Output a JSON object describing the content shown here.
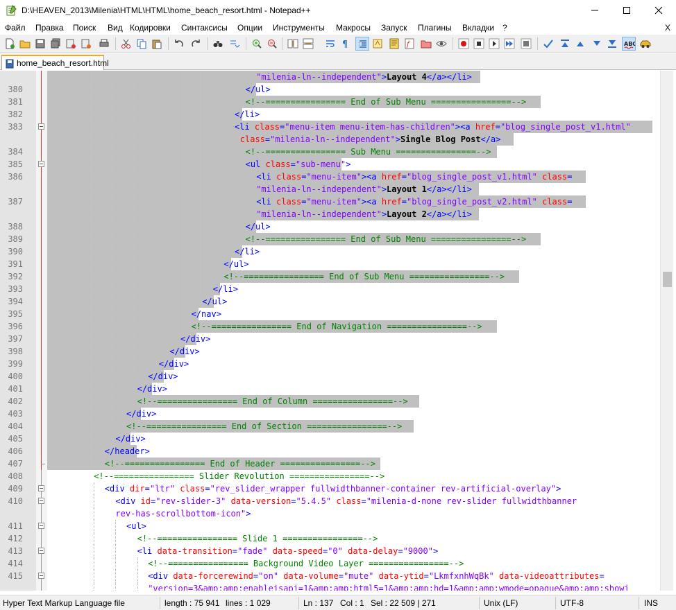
{
  "window": {
    "title": "D:\\HEAVEN_2013\\Milenia\\HTML\\HTML\\home_beach_resort.html - Notepad++"
  },
  "menu": {
    "items": [
      "Файл",
      "Правка",
      "Поиск",
      "Вид",
      "Кодировки",
      "Синтаксисы",
      "Опции",
      "Инструменты",
      "Макросы",
      "Запуск",
      "Плагины",
      "Вкладки",
      "?"
    ],
    "close_label": "X"
  },
  "tab": {
    "label": "home_beach_resort.html"
  },
  "editor": {
    "lines": [
      {
        "n": "",
        "code": [
          [
            "val",
            "\"milenia-ln--independent\""
          ],
          [
            "tag",
            ">"
          ],
          [
            "txt",
            "Layout 4"
          ],
          [
            "tag",
            "</a></li>"
          ]
        ]
      },
      {
        "n": "380",
        "code": [
          [
            "tag",
            "</ul>"
          ]
        ]
      },
      {
        "n": "381",
        "code": [
          [
            "com",
            "<!--================ End of Sub Menu ================-->"
          ]
        ]
      },
      {
        "n": "382",
        "code": [
          [
            "tag",
            "</li>"
          ]
        ]
      },
      {
        "n": "383",
        "code": [
          [
            "tag",
            "<li "
          ],
          [
            "attr",
            "class"
          ],
          [
            "tag",
            "="
          ],
          [
            "val",
            "\"menu-item menu-item-has-children\""
          ],
          [
            "tag",
            "><a "
          ],
          [
            "attr",
            "href"
          ],
          [
            "tag",
            "="
          ],
          [
            "val",
            "\"blog_single_post_v1.html\""
          ]
        ]
      },
      {
        "n": "",
        "code": [
          [
            "attr",
            "class"
          ],
          [
            "tag",
            "="
          ],
          [
            "val",
            "\"milenia-ln--independent\""
          ],
          [
            "tag",
            ">"
          ],
          [
            "txt",
            "Single Blog Post"
          ],
          [
            "tag",
            "</a>"
          ]
        ]
      },
      {
        "n": "384",
        "code": [
          [
            "com",
            "<!--================ Sub Menu ================-->"
          ]
        ]
      },
      {
        "n": "385",
        "code": [
          [
            "tag",
            "<ul "
          ],
          [
            "attr",
            "class"
          ],
          [
            "tag",
            "="
          ],
          [
            "val",
            "\"sub-menu\""
          ],
          [
            "tag",
            ">"
          ]
        ]
      },
      {
        "n": "386",
        "code": [
          [
            "tag",
            "<li "
          ],
          [
            "attr",
            "class"
          ],
          [
            "tag",
            "="
          ],
          [
            "val",
            "\"menu-item\""
          ],
          [
            "tag",
            "><a "
          ],
          [
            "attr",
            "href"
          ],
          [
            "tag",
            "="
          ],
          [
            "val",
            "\"blog_single_post_v1.html\""
          ],
          [
            "tag",
            " "
          ],
          [
            "attr",
            "class"
          ],
          [
            "tag",
            "="
          ]
        ]
      },
      {
        "n": "",
        "code": [
          [
            "val",
            "\"milenia-ln--independent\""
          ],
          [
            "tag",
            ">"
          ],
          [
            "txt",
            "Layout 1"
          ],
          [
            "tag",
            "</a></li>"
          ]
        ]
      },
      {
        "n": "387",
        "code": [
          [
            "tag",
            "<li "
          ],
          [
            "attr",
            "class"
          ],
          [
            "tag",
            "="
          ],
          [
            "val",
            "\"menu-item\""
          ],
          [
            "tag",
            "><a "
          ],
          [
            "attr",
            "href"
          ],
          [
            "tag",
            "="
          ],
          [
            "val",
            "\"blog_single_post_v2.html\""
          ],
          [
            "tag",
            " "
          ],
          [
            "attr",
            "class"
          ],
          [
            "tag",
            "="
          ]
        ]
      },
      {
        "n": "",
        "code": [
          [
            "val",
            "\"milenia-ln--independent\""
          ],
          [
            "tag",
            ">"
          ],
          [
            "txt",
            "Layout 2"
          ],
          [
            "tag",
            "</a></li>"
          ]
        ]
      },
      {
        "n": "388",
        "code": [
          [
            "tag",
            "</ul>"
          ]
        ]
      },
      {
        "n": "389",
        "code": [
          [
            "com",
            "<!--================ End of Sub Menu ================-->"
          ]
        ]
      },
      {
        "n": "390",
        "code": [
          [
            "tag",
            "</li>"
          ]
        ]
      },
      {
        "n": "391",
        "code": [
          [
            "tag",
            "</ul>"
          ]
        ]
      },
      {
        "n": "392",
        "code": [
          [
            "com",
            "<!--================ End of Sub Menu ================-->"
          ]
        ]
      },
      {
        "n": "393",
        "code": [
          [
            "tag",
            "</li>"
          ]
        ]
      },
      {
        "n": "394",
        "code": [
          [
            "tag",
            "</ul>"
          ]
        ]
      },
      {
        "n": "395",
        "code": [
          [
            "tag",
            "</nav>"
          ]
        ]
      },
      {
        "n": "396",
        "code": [
          [
            "com",
            "<!--================ End of Navigation ================-->"
          ]
        ]
      },
      {
        "n": "397",
        "code": [
          [
            "tag",
            "</div>"
          ]
        ]
      },
      {
        "n": "398",
        "code": [
          [
            "tag",
            "</div>"
          ]
        ]
      },
      {
        "n": "399",
        "code": [
          [
            "tag",
            "</div>"
          ]
        ]
      },
      {
        "n": "400",
        "code": [
          [
            "tag",
            "</div>"
          ]
        ]
      },
      {
        "n": "401",
        "code": [
          [
            "tag",
            "</div>"
          ]
        ]
      },
      {
        "n": "402",
        "code": [
          [
            "com",
            "<!--================ End of Column ================-->"
          ]
        ]
      },
      {
        "n": "403",
        "code": [
          [
            "tag",
            "</div>"
          ]
        ]
      },
      {
        "n": "404",
        "code": [
          [
            "com",
            "<!--================ End of Section ================-->"
          ]
        ]
      },
      {
        "n": "405",
        "code": [
          [
            "tag",
            "</div>"
          ]
        ]
      },
      {
        "n": "406",
        "code": [
          [
            "tag",
            "</header>"
          ]
        ]
      },
      {
        "n": "407",
        "code": [
          [
            "com",
            "<!--================ End of Header ================-->"
          ]
        ]
      },
      {
        "n": "408",
        "code": [
          [
            "com",
            "<!--================ Slider Revolution ================-->"
          ]
        ]
      },
      {
        "n": "409",
        "code": [
          [
            "tag",
            "<div "
          ],
          [
            "attr",
            "dir"
          ],
          [
            "tag",
            "="
          ],
          [
            "val",
            "\"ltr\""
          ],
          [
            "tag",
            " "
          ],
          [
            "attr",
            "class"
          ],
          [
            "tag",
            "="
          ],
          [
            "val",
            "\"rev_slider_wrapper fullwidthbanner-container rev-artificial-overlay\""
          ],
          [
            "tag",
            ">"
          ]
        ]
      },
      {
        "n": "410",
        "code": [
          [
            "tag",
            "<div "
          ],
          [
            "attr",
            "id"
          ],
          [
            "tag",
            "="
          ],
          [
            "val",
            "\"rev-slider-3\""
          ],
          [
            "tag",
            " "
          ],
          [
            "attr",
            "data-version"
          ],
          [
            "tag",
            "="
          ],
          [
            "val",
            "\"5.4.5\""
          ],
          [
            "tag",
            " "
          ],
          [
            "attr",
            "class"
          ],
          [
            "tag",
            "="
          ],
          [
            "val",
            "\"milenia-d-none rev-slider fullwidthbanner"
          ]
        ]
      },
      {
        "n": "",
        "code": [
          [
            "val",
            "rev-has-scrollbottom-icon\""
          ],
          [
            "tag",
            ">"
          ]
        ]
      },
      {
        "n": "411",
        "code": [
          [
            "tag",
            "<ul>"
          ]
        ]
      },
      {
        "n": "412",
        "code": [
          [
            "com",
            "<!--================ Slide 1 ================-->"
          ]
        ]
      },
      {
        "n": "413",
        "code": [
          [
            "tag",
            "<li "
          ],
          [
            "attr",
            "data-transition"
          ],
          [
            "tag",
            "="
          ],
          [
            "val",
            "\"fade\""
          ],
          [
            "tag",
            " "
          ],
          [
            "attr",
            "data-speed"
          ],
          [
            "tag",
            "="
          ],
          [
            "val",
            "\"0\""
          ],
          [
            "tag",
            " "
          ],
          [
            "attr",
            "data-delay"
          ],
          [
            "tag",
            "="
          ],
          [
            "val",
            "\"9000\""
          ],
          [
            "tag",
            ">"
          ]
        ]
      },
      {
        "n": "414",
        "code": [
          [
            "com",
            "<!--================ Background Video Layer ================-->"
          ]
        ]
      },
      {
        "n": "415",
        "code": [
          [
            "tag",
            "<div "
          ],
          [
            "attr",
            "data-forcerewind"
          ],
          [
            "tag",
            "="
          ],
          [
            "val",
            "\"on\""
          ],
          [
            "tag",
            " "
          ],
          [
            "attr",
            "data-volume"
          ],
          [
            "tag",
            "="
          ],
          [
            "val",
            "\"mute\""
          ],
          [
            "tag",
            " "
          ],
          [
            "attr",
            "data-ytid"
          ],
          [
            "tag",
            "="
          ],
          [
            "val",
            "\"LkmfxnhWqBk\""
          ],
          [
            "tag",
            " "
          ],
          [
            "attr",
            "data-videoattributes"
          ],
          [
            "tag",
            "="
          ]
        ]
      },
      {
        "n": "",
        "code": [
          [
            "val",
            "\"version=3&amp;amp;enablejsapi=1&amp;amp;html5=1&amp;amp;hd=1&amp;amp;wmode=opaque&amp;amp;showi"
          ]
        ]
      }
    ]
  },
  "status": {
    "language": "Hyper Text Markup Language file",
    "length": "length : 75 941",
    "lines": "lines : 1 029",
    "ln": "Ln : 137",
    "col": "Col : 1",
    "sel": "Sel : 22 509 | 271",
    "eol": "Unix (LF)",
    "encoding": "UTF-8",
    "mode": "INS"
  }
}
